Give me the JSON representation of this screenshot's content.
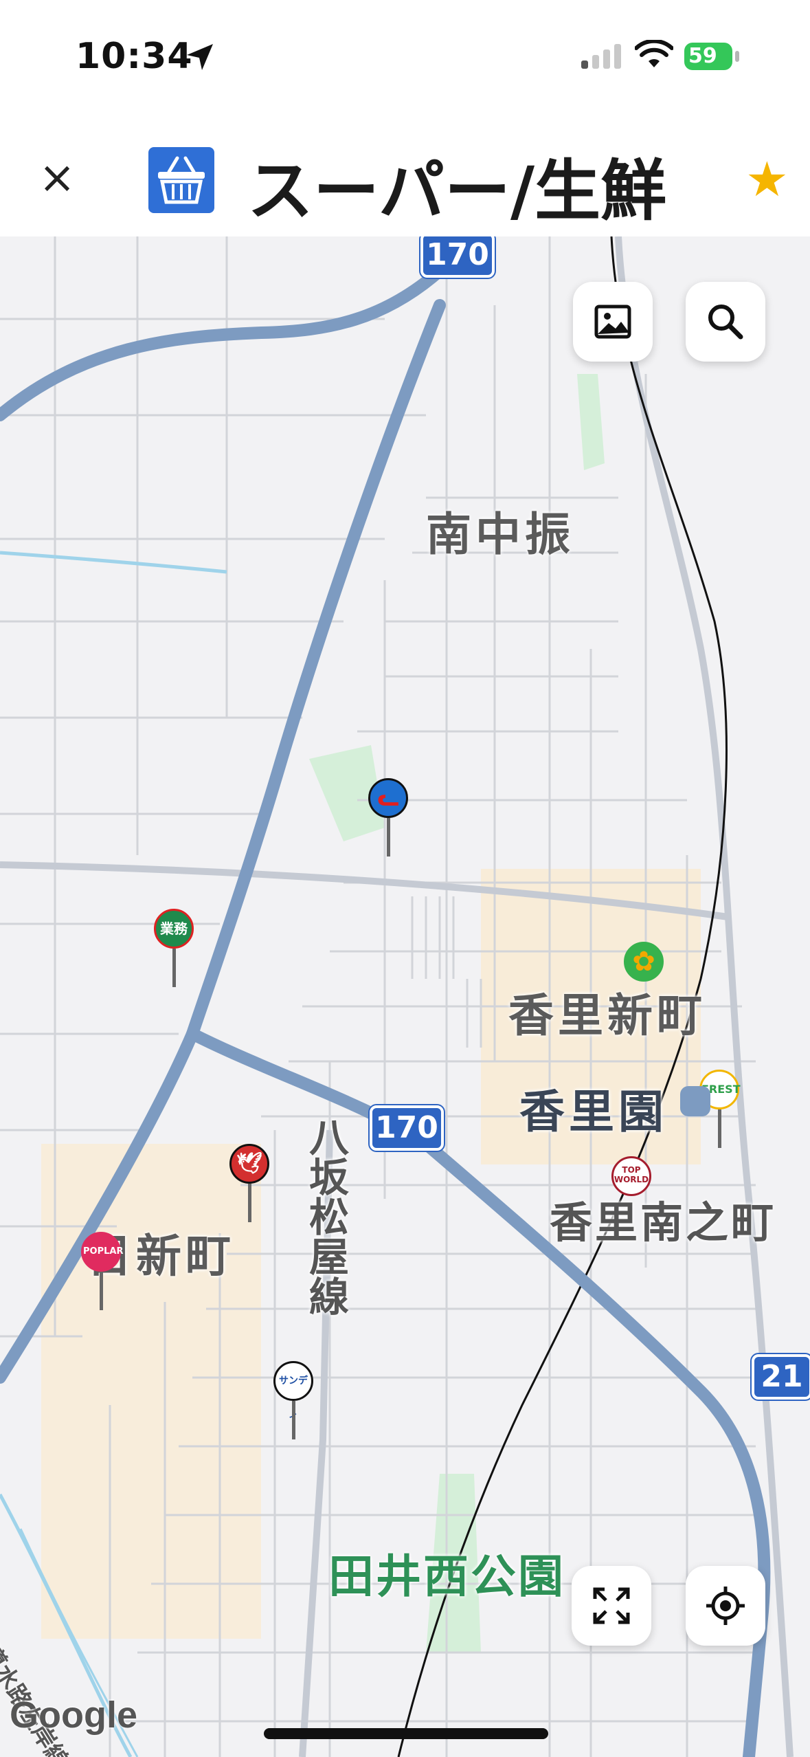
{
  "status_bar": {
    "time": "10:34",
    "battery": "59"
  },
  "header": {
    "title": "スーパー/生鮮",
    "close_icon": "×",
    "category_icon": "basket-icon",
    "favorite_icon": "star-icon"
  },
  "map": {
    "labels": {
      "minaminakaburi": "南中振",
      "kourishinmachi": "香里新町",
      "kourien": "香里園",
      "kourinaminomachi": "香里南之町",
      "hinishinmachi": "日新町",
      "yasakamatsuyasen": "八坂松屋線",
      "tainishikouen": "田井西公園",
      "canal": "淀川導水路左岸線"
    },
    "route_shields": [
      "170",
      "170",
      "21"
    ],
    "pins": [
      {
        "name": "store-pin-1",
        "text": "",
        "color": "#1e6fd0"
      },
      {
        "name": "store-pin-gyomu",
        "text": "業務",
        "color": "#1f8a4c"
      },
      {
        "name": "store-pin-clover",
        "text": "",
        "color": "#37b24d"
      },
      {
        "name": "store-pin-frest",
        "text": "FREST",
        "color": "#f2b600"
      },
      {
        "name": "store-pin-topworld",
        "text": "TOP WORLD",
        "color": "#a51d2d"
      },
      {
        "name": "store-pin-bird",
        "text": "",
        "color": "#d32f2f"
      },
      {
        "name": "store-pin-popura",
        "text": "POPLAR",
        "color": "#e02b5f"
      },
      {
        "name": "store-pin-sandi",
        "text": "サンディ",
        "color": "#1e4fa3"
      }
    ],
    "attribution": "Google"
  }
}
